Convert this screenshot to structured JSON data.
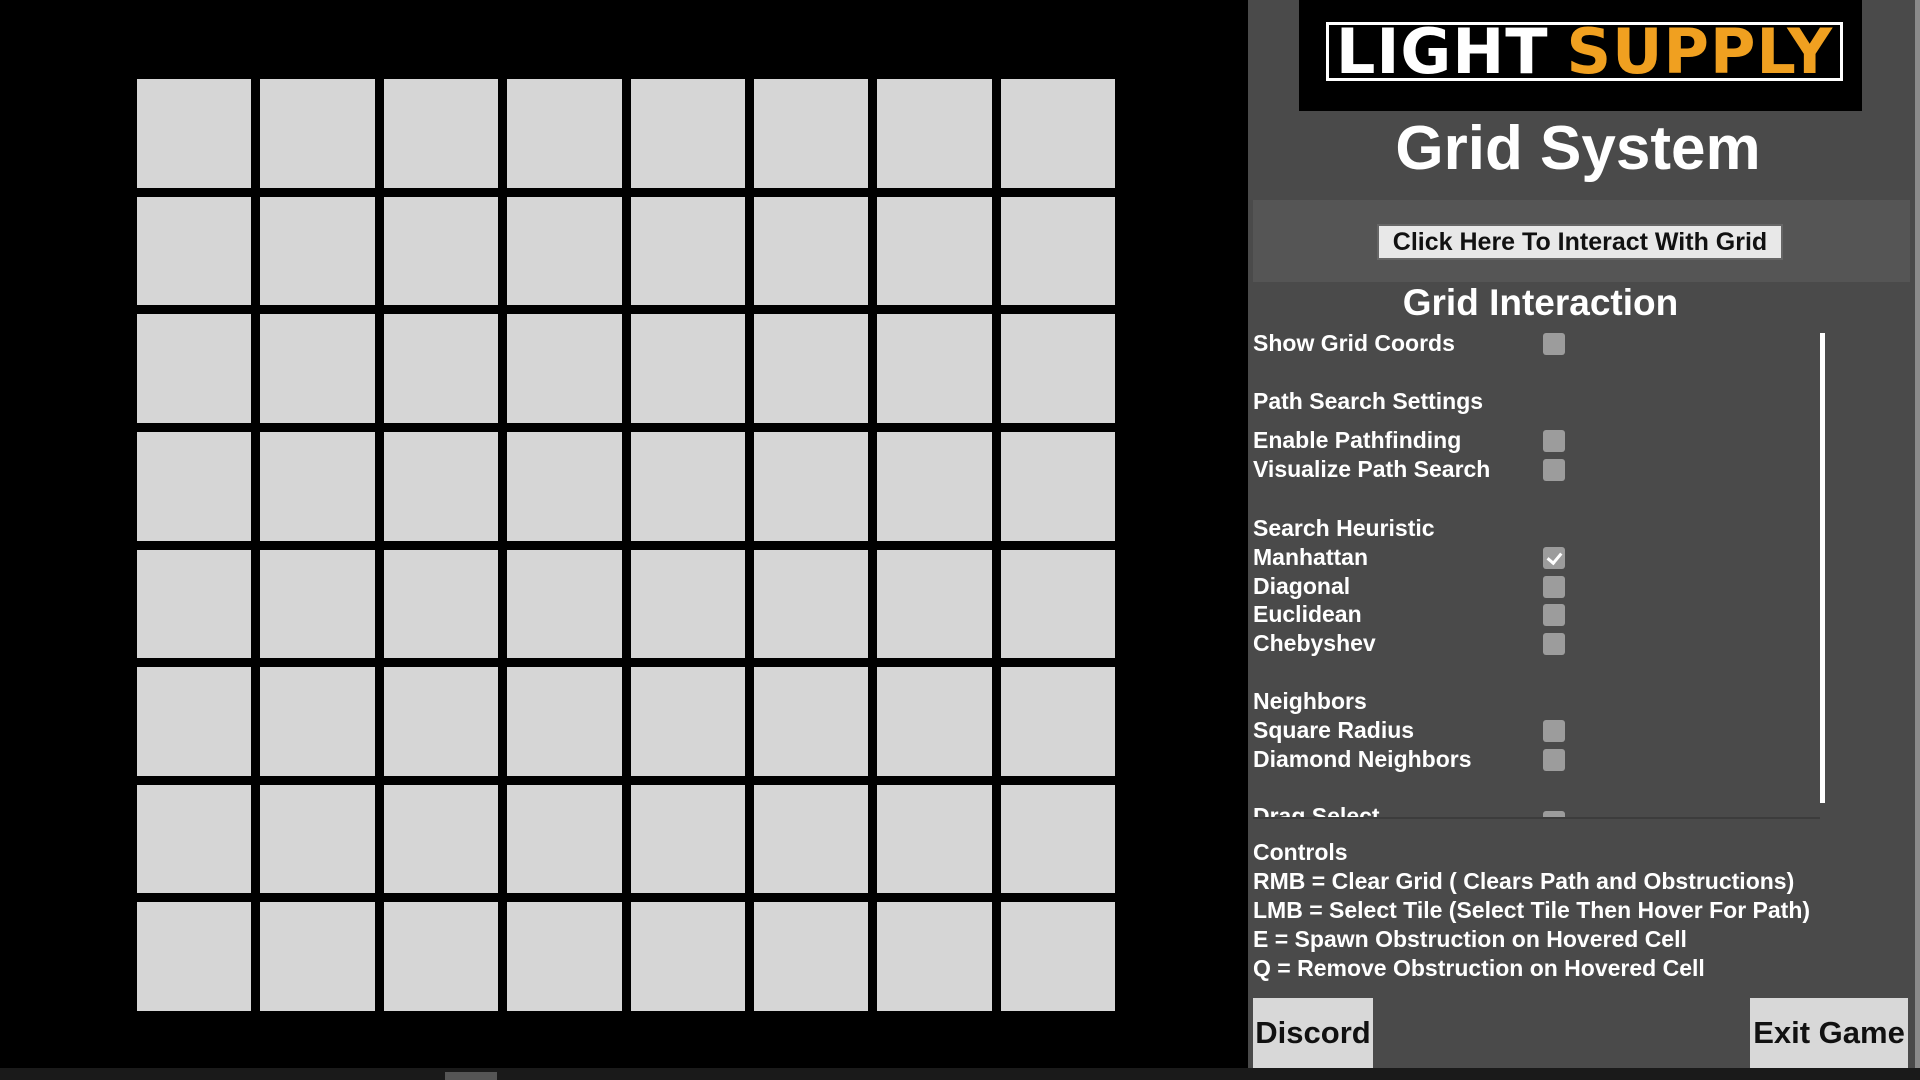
{
  "logo": {
    "light": "LIGHT",
    "supply": "SUPPLY",
    "light_color": "#ffffff",
    "supply_color": "#f0a020"
  },
  "panel": {
    "title": "Grid System",
    "interact_button": "Click Here To Interact With Grid",
    "section_title": "Grid Interaction",
    "options": {
      "show_grid_coords": {
        "label": "Show Grid Coords",
        "checked": false
      },
      "path_search_heading": "Path Search Settings",
      "enable_pathfinding": {
        "label": "Enable Pathfinding",
        "checked": false
      },
      "visualize_path_search": {
        "label": "Visualize Path Search",
        "checked": false
      },
      "search_heuristic_heading": "Search Heuristic",
      "manhattan": {
        "label": "Manhattan",
        "checked": true
      },
      "diagonal": {
        "label": "Diagonal",
        "checked": false
      },
      "euclidean": {
        "label": "Euclidean",
        "checked": false
      },
      "chebyshev": {
        "label": "Chebyshev",
        "checked": false
      },
      "neighbors_heading": "Neighbors",
      "square_radius": {
        "label": "Square Radius",
        "checked": false
      },
      "diamond_neighbors": {
        "label": "Diamond Neighbors",
        "checked": false
      },
      "drag_select": {
        "label": "Drag Select",
        "checked": false
      }
    },
    "controls": {
      "heading": "Controls",
      "rmb": "RMB = Clear Grid ( Clears Path and Obstructions)",
      "lmb": "LMB = Select Tile (Select Tile Then Hover For Path)",
      "e": "E = Spawn Obstruction on Hovered Cell",
      "q": "Q = Remove Obstruction on Hovered Cell"
    },
    "discord_button": "Discord",
    "exit_button": "Exit Game"
  },
  "grid": {
    "rows": 8,
    "cols": 8,
    "cell_color": "#d6d6d6"
  }
}
